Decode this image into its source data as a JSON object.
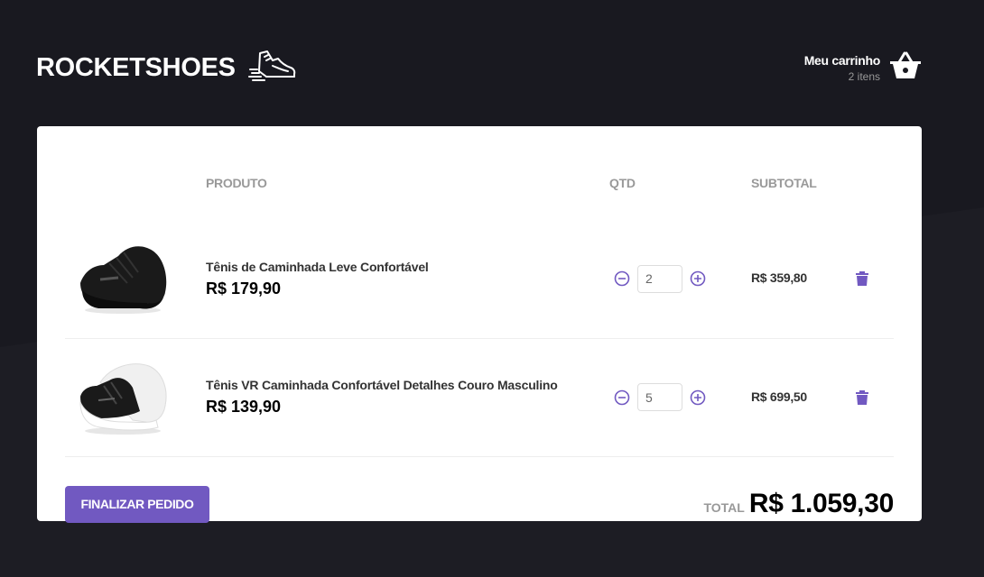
{
  "header": {
    "logo_text": "ROCKETSHOES",
    "cart_title": "Meu carrinho",
    "cart_count": "2 itens"
  },
  "table": {
    "col_product": "PRODUTO",
    "col_qty": "QTD",
    "col_subtotal": "SUBTOTAL",
    "items": [
      {
        "name": "Tênis de Caminhada Leve Confortável",
        "price": "R$ 179,90",
        "quantity": "2",
        "subtotal": "R$ 359,80",
        "image": "black-sneaker-black-sole"
      },
      {
        "name": "Tênis VR Caminhada Confortável Detalhes Couro Masculino",
        "price": "R$ 139,90",
        "quantity": "5",
        "subtotal": "R$ 699,50",
        "image": "black-sneaker-white-sole"
      }
    ]
  },
  "footer": {
    "finish_label": "FINALIZAR PEDIDO",
    "total_label": "TOTAL",
    "total_value": "R$ 1.059,30"
  },
  "colors": {
    "background": "#191920",
    "accent": "#7159c1",
    "panel": "#ffffff"
  },
  "icons": [
    "running-shoe-icon",
    "shopping-basket-icon",
    "minus-circle-icon",
    "plus-circle-icon",
    "trash-icon"
  ]
}
